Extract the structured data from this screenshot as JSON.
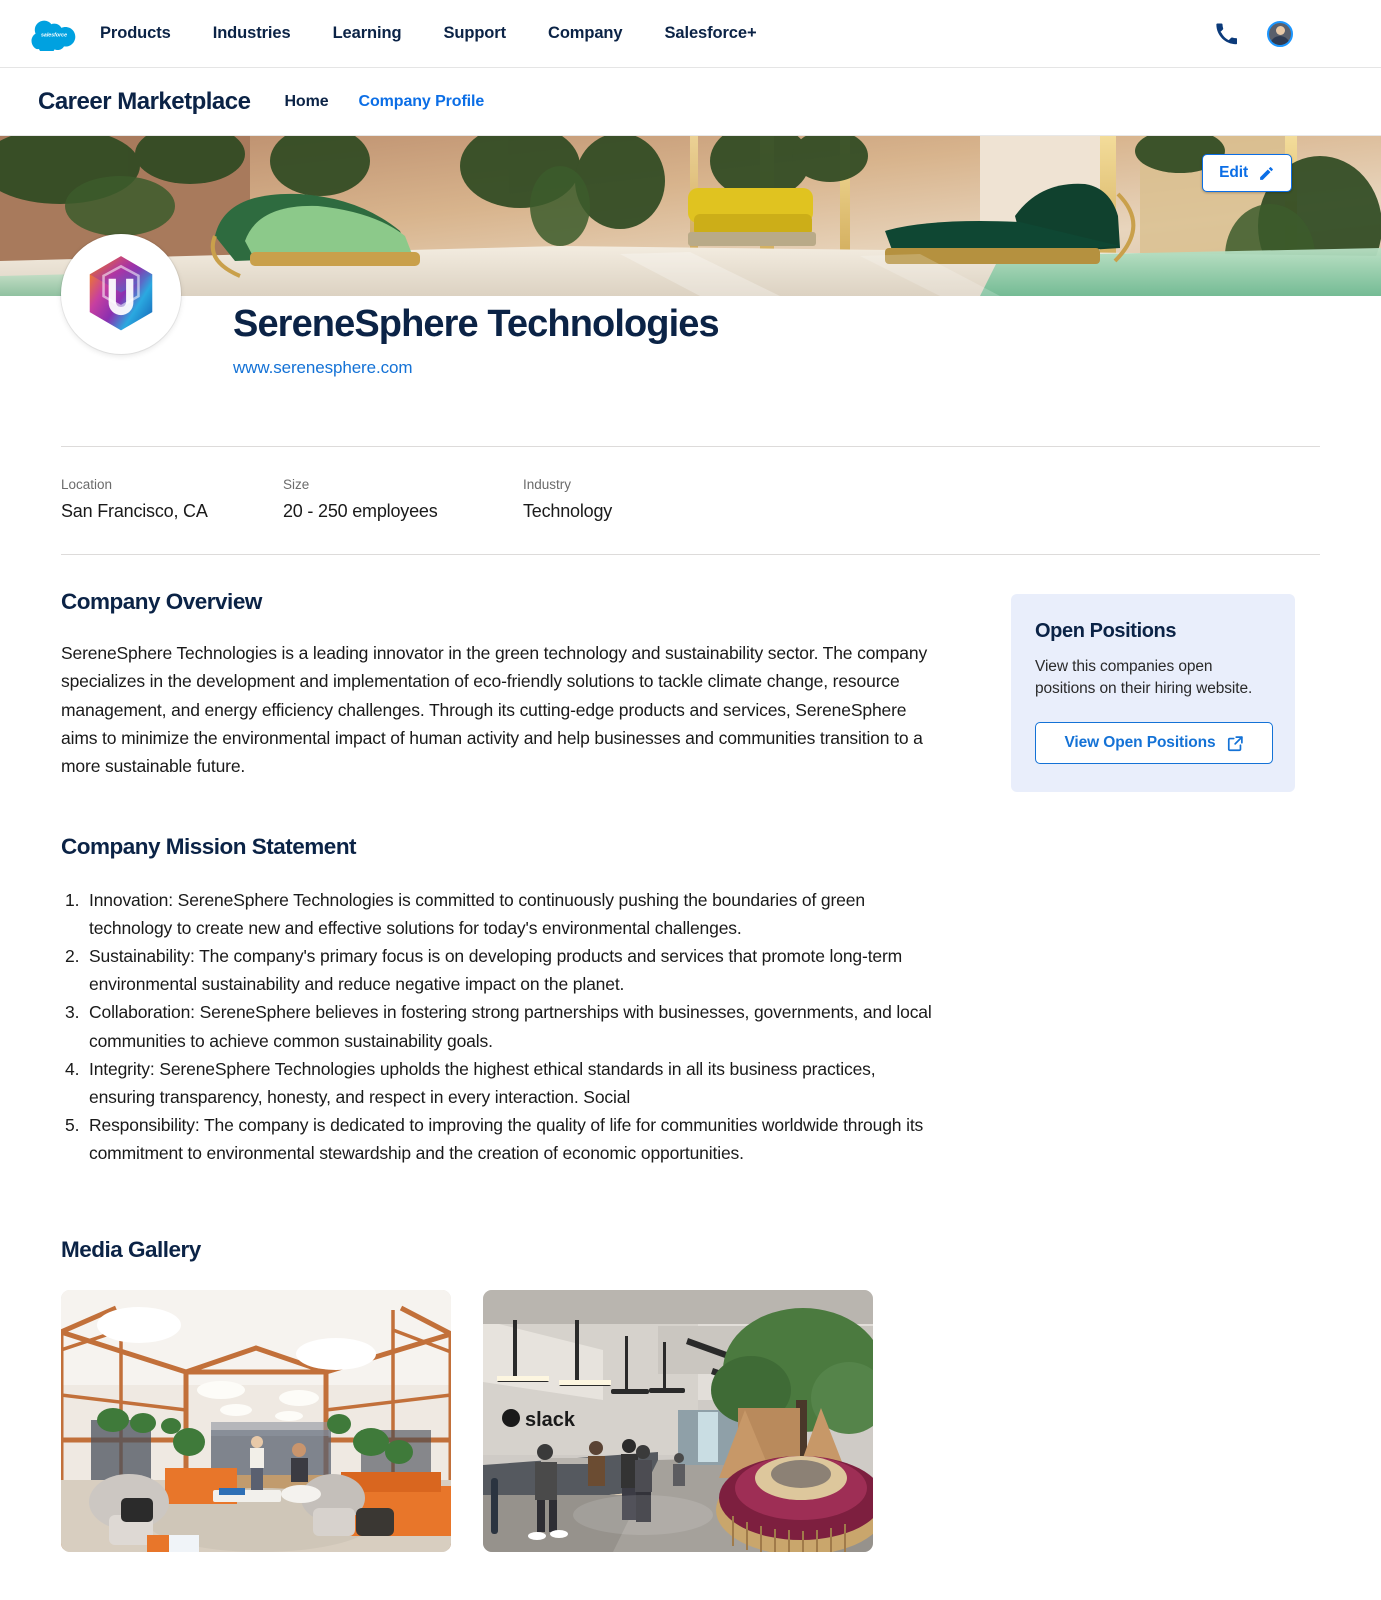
{
  "top_nav": {
    "logo_icon": "salesforce-cloud-logo",
    "links": [
      {
        "label": "Products"
      },
      {
        "label": "Industries"
      },
      {
        "label": "Learning"
      },
      {
        "label": "Support"
      },
      {
        "label": "Company"
      },
      {
        "label": "Salesforce+"
      }
    ],
    "phone_icon": "phone-icon",
    "avatar_icon": "user-avatar"
  },
  "sub_nav": {
    "app_title": "Career Marketplace",
    "links": [
      {
        "label": "Home",
        "active": false
      },
      {
        "label": "Company Profile",
        "active": true
      }
    ]
  },
  "hero": {
    "banner_alt": "luxury-spa-interior-banner",
    "edit_button": {
      "label": "Edit",
      "icon": "pencil-icon"
    }
  },
  "company": {
    "logo_icon": "serenesphere-hexagon-logo",
    "name": "SereneSphere Technologies",
    "website": "www.serenesphere.com",
    "meta": [
      {
        "label": "Location",
        "value": "San Francisco, CA"
      },
      {
        "label": "Size",
        "value": "20 - 250 employees"
      },
      {
        "label": "Industry",
        "value": "Technology"
      }
    ]
  },
  "overview": {
    "title": "Company Overview",
    "text": "SereneSphere Technologies is a leading innovator in the green technology and sustainability sector. The company specializes in the development and implementation of eco-friendly solutions to tackle climate change, resource management, and energy efficiency challenges. Through its cutting-edge products and services, SereneSphere aims to minimize the environmental impact of human activity and help businesses and communities transition to a more sustainable future."
  },
  "mission": {
    "title": "Company Mission Statement",
    "items": [
      "Innovation: SereneSphere Technologies is committed to continuously pushing the boundaries of green technology to create new and effective solutions for today's environmental challenges.",
      "Sustainability: The company's primary focus is on developing products and services that promote long-term environmental sustainability and reduce negative impact on the planet.",
      "Collaboration: SereneSphere believes in fostering strong partnerships with businesses, governments, and local communities to achieve common sustainability goals.",
      "Integrity: SereneSphere Technologies upholds the highest ethical standards in all its business practices, ensuring transparency, honesty, and respect in every interaction. Social",
      "Responsibility: The company is dedicated to improving the quality of life for communities worldwide through its commitment to environmental stewardship and the creation of economic opportunities."
    ]
  },
  "open_positions": {
    "title": "Open Positions",
    "description": "View this companies open positions on their hiring website.",
    "button_label": "View Open Positions",
    "button_icon": "external-link-icon",
    "card_bg": "#e9eefb"
  },
  "media_gallery": {
    "title": "Media Gallery",
    "items": [
      {
        "alt": "office-lounge-with-wooden-frame-and-orange-sofas"
      },
      {
        "alt": "slack-office-lobby-reception"
      }
    ]
  },
  "colors": {
    "brand_navy": "#0b2346",
    "link_blue": "#0b6ee6",
    "accent_blue": "#1472d6",
    "salesforce_blue": "#00a1e0"
  }
}
